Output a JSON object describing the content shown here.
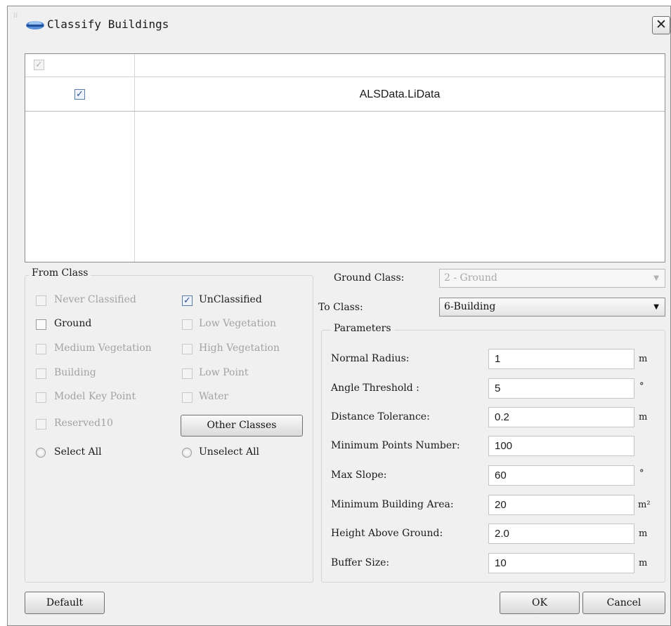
{
  "dialog": {
    "title": "Classify Buildings",
    "close_label": "✕"
  },
  "data_table": {
    "rows": [
      {
        "name": "ALSData.LiData",
        "checked": true
      }
    ]
  },
  "from_class": {
    "title": "From Class",
    "items": [
      {
        "label": "Never Classified",
        "checked": false,
        "enabled": false
      },
      {
        "label": "UnClassified",
        "checked": true,
        "enabled": true
      },
      {
        "label": "Ground",
        "checked": false,
        "enabled": true
      },
      {
        "label": "Low Vegetation",
        "checked": false,
        "enabled": false
      },
      {
        "label": "Medium Vegetation",
        "checked": false,
        "enabled": false
      },
      {
        "label": "High Vegetation",
        "checked": false,
        "enabled": false
      },
      {
        "label": "Building",
        "checked": false,
        "enabled": false
      },
      {
        "label": "Low Point",
        "checked": false,
        "enabled": false
      },
      {
        "label": "Model Key Point",
        "checked": false,
        "enabled": false
      },
      {
        "label": "Water",
        "checked": false,
        "enabled": false
      },
      {
        "label": "Reserved10",
        "checked": false,
        "enabled": false
      }
    ],
    "other_classes_label": "Other Classes",
    "select_all_label": "Select All",
    "unselect_all_label": "Unselect All"
  },
  "ground_class": {
    "label": "Ground   Class:",
    "value": "2 - Ground"
  },
  "to_class": {
    "label": "To Class:",
    "value": "6-Building"
  },
  "parameters": {
    "title": "Parameters",
    "fields": [
      {
        "label": "Normal Radius:",
        "value": "1",
        "unit": "m"
      },
      {
        "label": "Angle Threshold :",
        "value": "5",
        "unit": "°"
      },
      {
        "label": "Distance Tolerance:",
        "value": "0.2",
        "unit": "m"
      },
      {
        "label": "Minimum Points Number:",
        "value": "100",
        "unit": ""
      },
      {
        "label": "Max Slope:",
        "value": "60",
        "unit": "°"
      },
      {
        "label": "Minimum Building Area:",
        "value": "20",
        "unit": "m²"
      },
      {
        "label": "Height Above Ground:",
        "value": "2.0",
        "unit": "m"
      },
      {
        "label": "Buffer Size:",
        "value": "10",
        "unit": "m"
      }
    ]
  },
  "footer": {
    "default_label": "Default",
    "ok_label": "OK",
    "cancel_label": "Cancel"
  },
  "icons": {
    "check": "check-icon",
    "dropdown": "chevron-down-icon",
    "app": "app-logo-icon"
  }
}
